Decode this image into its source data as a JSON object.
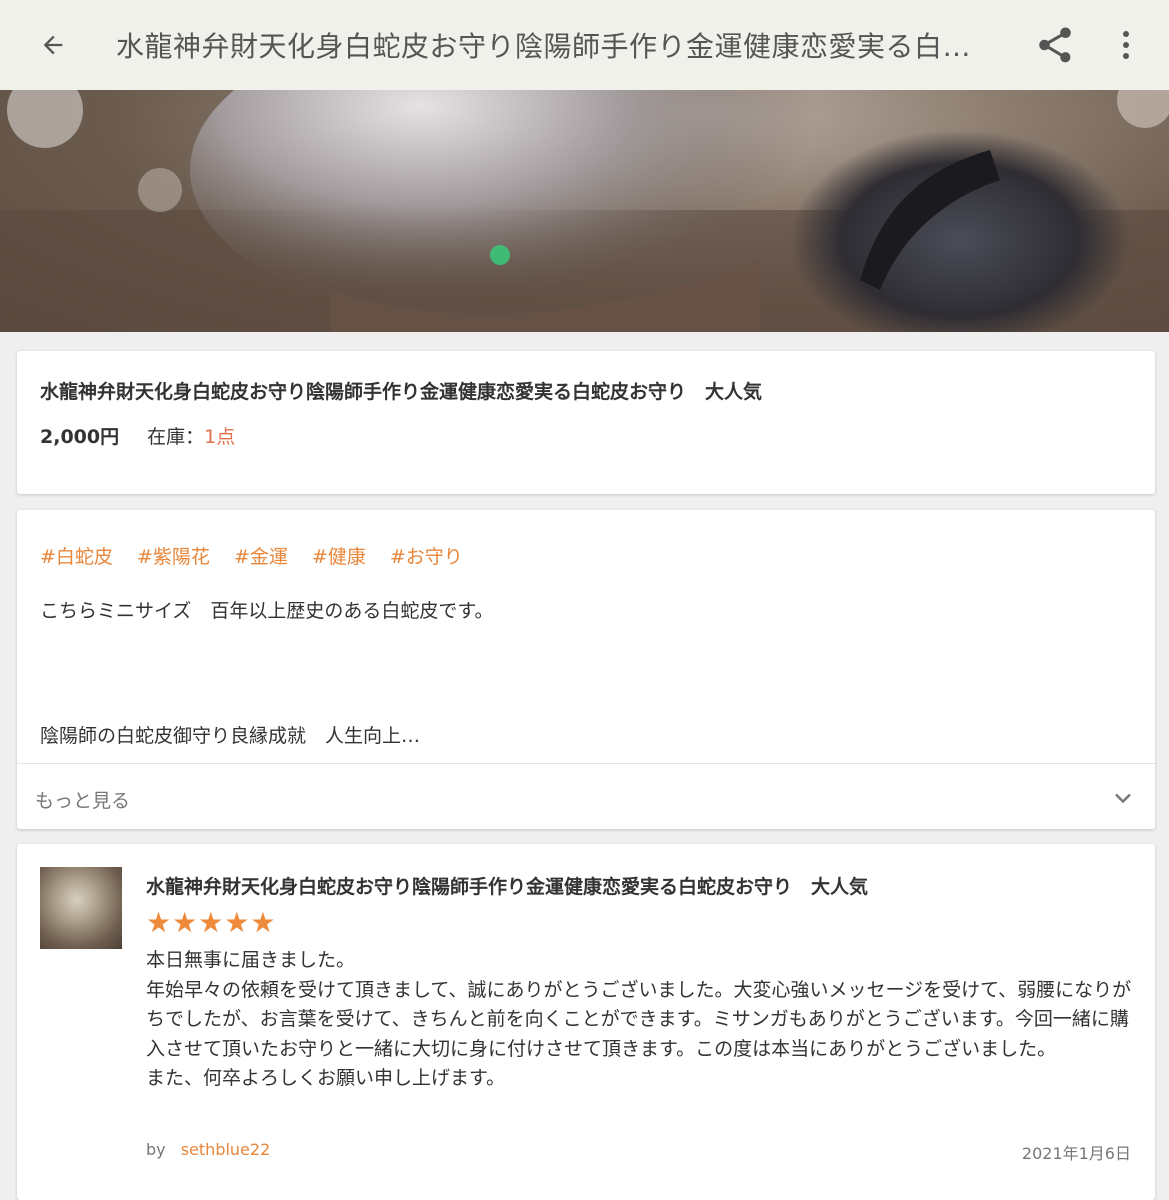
{
  "appbar": {
    "title": "水龍神弁財天化身白蛇皮お守り陰陽師手作り金運健康恋愛実る白蛇皮お守り 大人気"
  },
  "product": {
    "title": "水龍神弁財天化身白蛇皮お守り陰陽師手作り金運健康恋愛実る白蛇皮お守り　大人気",
    "price": "2,000円",
    "stock_label": "在庫：",
    "stock_value": "1点"
  },
  "description": {
    "tags": [
      "#白蛇皮",
      "#紫陽花",
      "#金運",
      "#健康",
      "#お守り"
    ],
    "line1": "こちらミニサイズ　百年以上歴史のある白蛇皮です。",
    "line2": "陰陽師の白蛇皮御守り良縁成就　人生向上…",
    "more_label": "もっと見る"
  },
  "review": {
    "title": "水龍神弁財天化身白蛇皮お守り陰陽師手作り金運健康恋愛実る白蛇皮お守り　大人気",
    "stars": "★★★★★",
    "rating": 5,
    "body": [
      "本日無事に届きました。",
      "年始早々の依頼を受けて頂きまして、誠にありがとうございました。大変心強いメッセージを受けて、弱腰になりがちでしたが、お言葉を受けて、きちんと前を向くことができます。ミサンガもありがとうございます。今回一緒に購入させて頂いたお守りと一緒に大切に身に付けさせて頂きます。この度は本当にありがとうございました。",
      "また、何卒よろしくお願い申し上げます。"
    ],
    "by_label": "by",
    "user": "sethblue22",
    "date": "2021年1月6日"
  },
  "colors": {
    "accent": "#e8863a",
    "stock": "#e0704a",
    "background": "#efefef"
  }
}
